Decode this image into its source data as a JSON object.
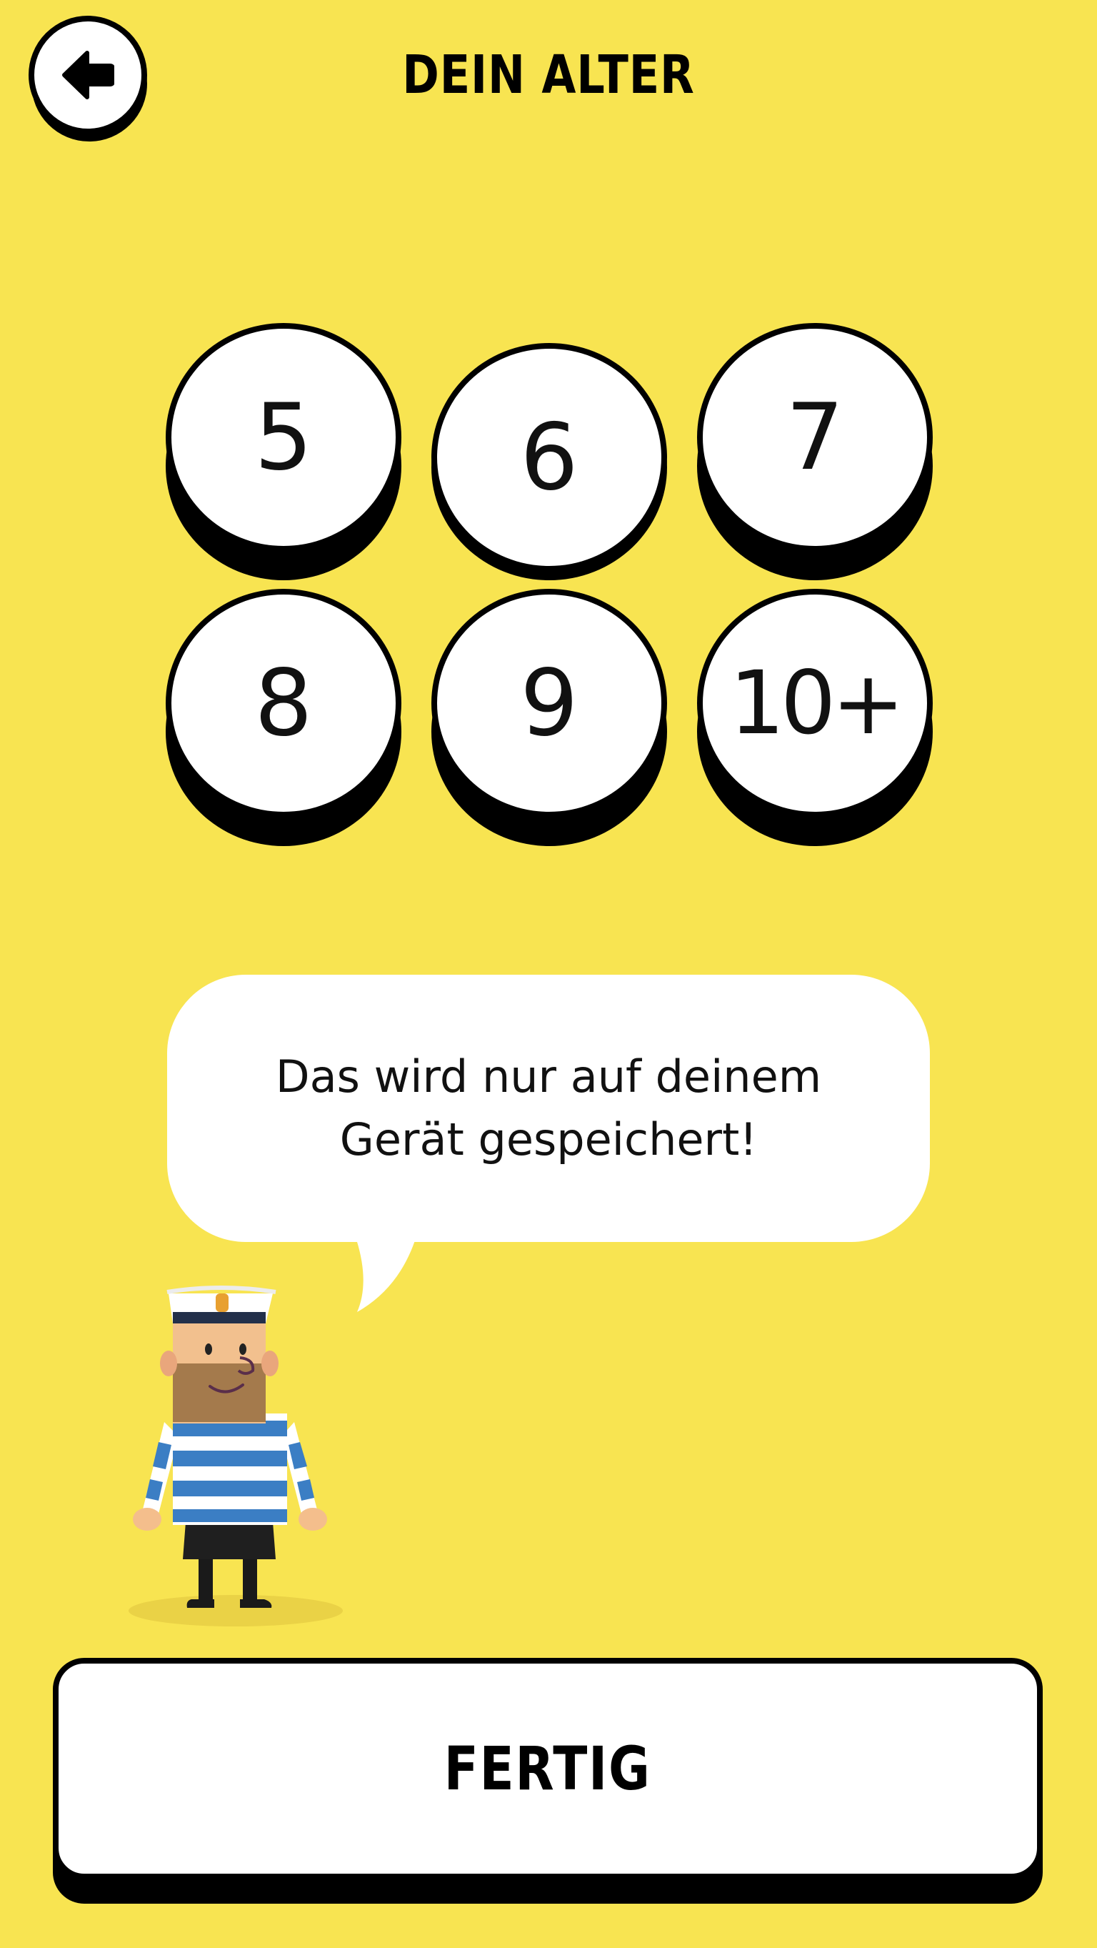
{
  "header": {
    "title": "DEIN ALTER",
    "back_icon": "arrow-left-icon"
  },
  "age_options": {
    "items": [
      {
        "label": "5",
        "selected": false
      },
      {
        "label": "6",
        "selected": true
      },
      {
        "label": "7",
        "selected": false
      },
      {
        "label": "8",
        "selected": false
      },
      {
        "label": "9",
        "selected": false
      },
      {
        "label": "10+",
        "selected": false
      }
    ]
  },
  "bubble": {
    "line1": "Das wird nur auf deinem",
    "line2": "Gerät gespeichert!"
  },
  "footer": {
    "done_label": "FERTIG"
  },
  "colors": {
    "background": "#F8E451",
    "button_face": "#FFFFFF",
    "outline": "#000000",
    "stripe_blue": "#3B7EC4"
  }
}
